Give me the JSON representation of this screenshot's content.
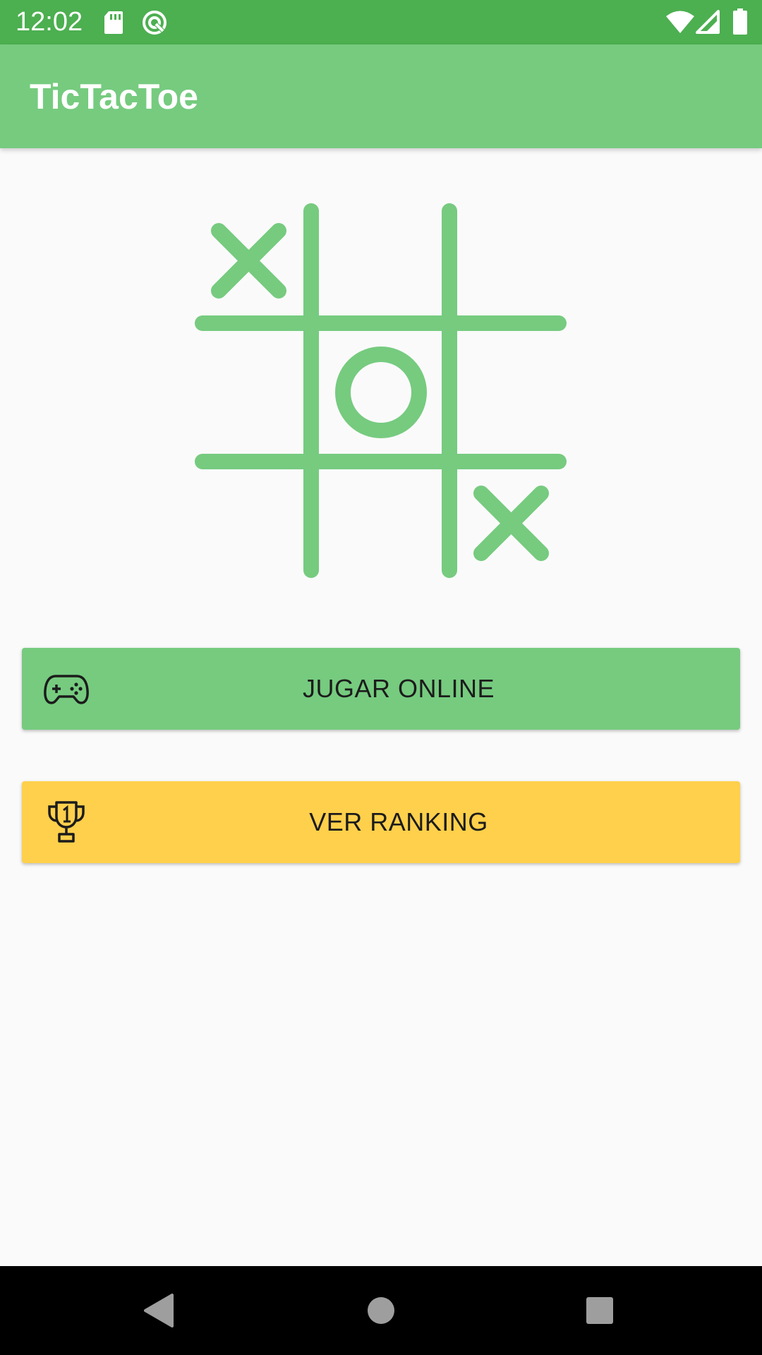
{
  "status_bar": {
    "time": "12:02",
    "icons": [
      "sd-card-icon",
      "sync-icon",
      "wifi-icon",
      "cell-signal-icon",
      "battery-icon"
    ]
  },
  "app_bar": {
    "title": "TicTacToe"
  },
  "board": {
    "cells": [
      "X",
      "",
      "",
      "",
      "O",
      "",
      "",
      "",
      "X"
    ],
    "color": "#76cb7f"
  },
  "buttons": {
    "online": {
      "label": "JUGAR ONLINE",
      "icon": "gamepad-icon",
      "color": "#76cb7f"
    },
    "ranking": {
      "label": "VER RANKING",
      "icon": "trophy-icon",
      "color": "#ffd04b"
    }
  },
  "nav_bar": {
    "icons": [
      "back-icon",
      "home-icon",
      "recents-icon"
    ]
  }
}
